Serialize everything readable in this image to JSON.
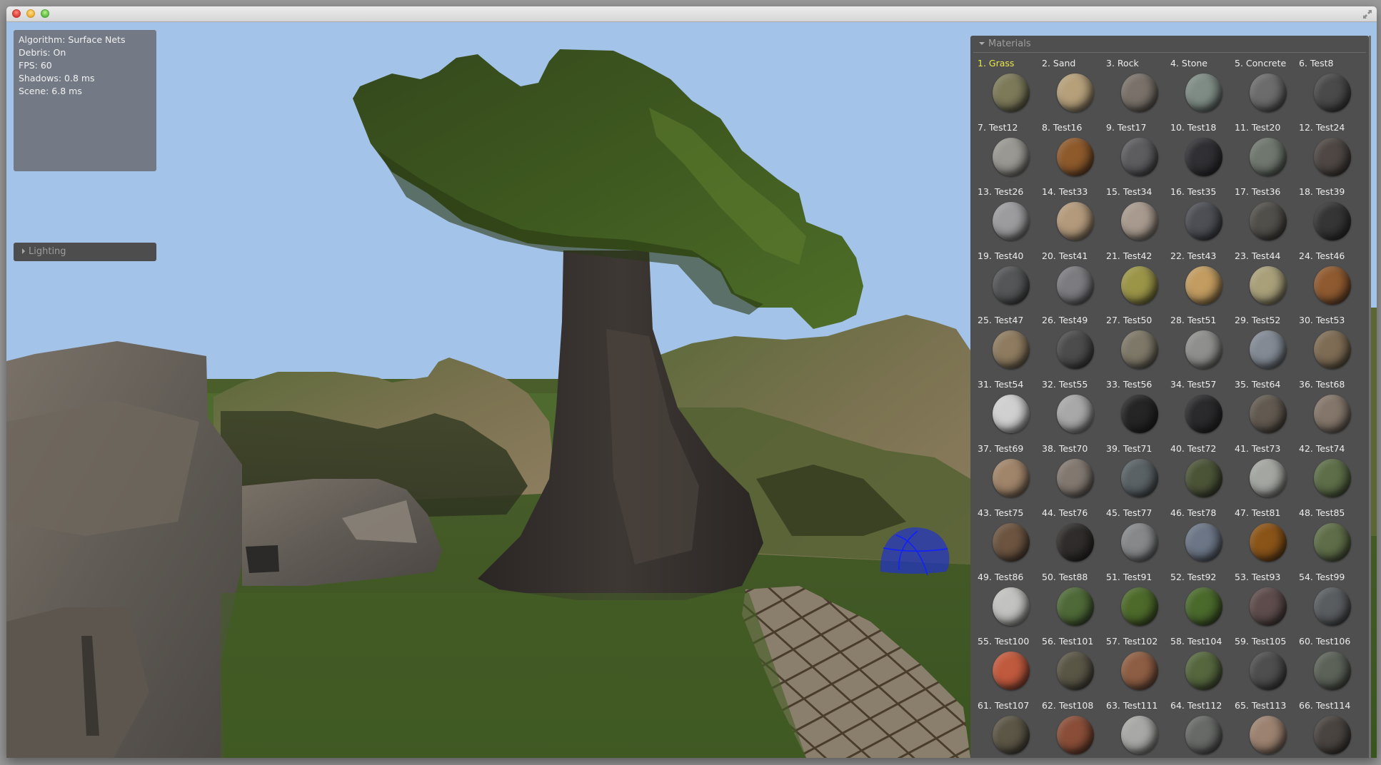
{
  "window": {
    "title": "",
    "controls": [
      "close",
      "minimize",
      "maximize",
      "fullscreen"
    ]
  },
  "stats": {
    "algorithm": "Algorithm: Surface Nets",
    "debris": "Debris: On",
    "fps": "FPS: 60",
    "shadows": "Shadows: 0.8 ms",
    "scene": "Scene: 6.8 ms"
  },
  "lighting": {
    "label": "Lighting",
    "expanded": false
  },
  "materials": {
    "title": "Materials",
    "expanded": true,
    "selected_index": 0,
    "selected_color": "#e8e84a",
    "items": [
      {
        "label": "1. Grass",
        "color": "#7d7a5a"
      },
      {
        "label": "2. Sand",
        "color": "#b5a07a"
      },
      {
        "label": "3. Rock",
        "color": "#7a726a"
      },
      {
        "label": "4. Stone",
        "color": "#7f8c86"
      },
      {
        "label": "5. Concrete",
        "color": "#6c6c6c"
      },
      {
        "label": "6. Test8",
        "color": "#4a4a4a"
      },
      {
        "label": "7. Test12",
        "color": "#9a9892"
      },
      {
        "label": "8. Test16",
        "color": "#8e5a2c"
      },
      {
        "label": "9. Test17",
        "color": "#5d5d60"
      },
      {
        "label": "10. Test18",
        "color": "#303034"
      },
      {
        "label": "11. Test20",
        "color": "#6f776e"
      },
      {
        "label": "12. Test24",
        "color": "#4e4744"
      },
      {
        "label": "13. Test26",
        "color": "#9c9c9e"
      },
      {
        "label": "14. Test33",
        "color": "#b49a7c"
      },
      {
        "label": "15. Test34",
        "color": "#a89a8e"
      },
      {
        "label": "16. Test35",
        "color": "#4d4f55"
      },
      {
        "label": "17. Test36",
        "color": "#514f4a"
      },
      {
        "label": "18. Test39",
        "color": "#353536"
      },
      {
        "label": "19. Test40",
        "color": "#555657"
      },
      {
        "label": "20. Test41",
        "color": "#7c7c80"
      },
      {
        "label": "21. Test42",
        "color": "#9b9548"
      },
      {
        "label": "22. Test43",
        "color": "#c29c60"
      },
      {
        "label": "23. Test44",
        "color": "#a9a07a"
      },
      {
        "label": "24. Test46",
        "color": "#8f5a30"
      },
      {
        "label": "25. Test47",
        "color": "#8f7c60"
      },
      {
        "label": "26. Test49",
        "color": "#4c4c4c"
      },
      {
        "label": "27. Test50",
        "color": "#7e7868"
      },
      {
        "label": "28. Test51",
        "color": "#8f8f8d"
      },
      {
        "label": "29. Test52",
        "color": "#838a94"
      },
      {
        "label": "30. Test53",
        "color": "#7e6c54"
      },
      {
        "label": "31. Test54",
        "color": "#d0d0d0"
      },
      {
        "label": "32. Test55",
        "color": "#a8a8a8"
      },
      {
        "label": "33. Test56",
        "color": "#252525"
      },
      {
        "label": "34. Test57",
        "color": "#2a2a2c"
      },
      {
        "label": "35. Test64",
        "color": "#625a50"
      },
      {
        "label": "36. Test68",
        "color": "#84766a"
      },
      {
        "label": "37. Test69",
        "color": "#a1856a"
      },
      {
        "label": "38. Test70",
        "color": "#827870"
      },
      {
        "label": "39. Test71",
        "color": "#5a6266"
      },
      {
        "label": "40. Test72",
        "color": "#4c5438"
      },
      {
        "label": "41. Test73",
        "color": "#a4a6a2"
      },
      {
        "label": "42. Test74",
        "color": "#5d6e48"
      },
      {
        "label": "43. Test75",
        "color": "#6c5440"
      },
      {
        "label": "44. Test76",
        "color": "#2f2c2b"
      },
      {
        "label": "45. Test77",
        "color": "#86888a"
      },
      {
        "label": "46. Test78",
        "color": "#6c7686"
      },
      {
        "label": "47. Test81",
        "color": "#8a5418"
      },
      {
        "label": "48. Test85",
        "color": "#5f6e48"
      },
      {
        "label": "49. Test86",
        "color": "#c2c2c0"
      },
      {
        "label": "50. Test88",
        "color": "#4f6a38"
      },
      {
        "label": "51. Test91",
        "color": "#4d6a2a"
      },
      {
        "label": "52. Test92",
        "color": "#4a6a2c"
      },
      {
        "label": "53. Test93",
        "color": "#5e4c4c"
      },
      {
        "label": "54. Test99",
        "color": "#5a5d60"
      },
      {
        "label": "55. Test100",
        "color": "#c05a3e"
      },
      {
        "label": "56. Test101",
        "color": "#5a5646"
      },
      {
        "label": "57. Test102",
        "color": "#8e5e44"
      },
      {
        "label": "58. Test104",
        "color": "#56673e"
      },
      {
        "label": "59. Test105",
        "color": "#4e4e4e"
      },
      {
        "label": "60. Test106",
        "color": "#5c6258"
      },
      {
        "label": "61. Test107",
        "color": "#5c5646"
      },
      {
        "label": "62. Test108",
        "color": "#8a4e38"
      },
      {
        "label": "63. Test111",
        "color": "#a8a8a6"
      },
      {
        "label": "64. Test112",
        "color": "#686a68"
      },
      {
        "label": "65. Test113",
        "color": "#9c8270"
      },
      {
        "label": "66. Test114",
        "color": "#4a4440"
      }
    ]
  },
  "scene": {
    "sky_color": "#a4c3e8",
    "ground_color": "#3f5a22",
    "selection_dome_color": "#1a2bd6"
  }
}
